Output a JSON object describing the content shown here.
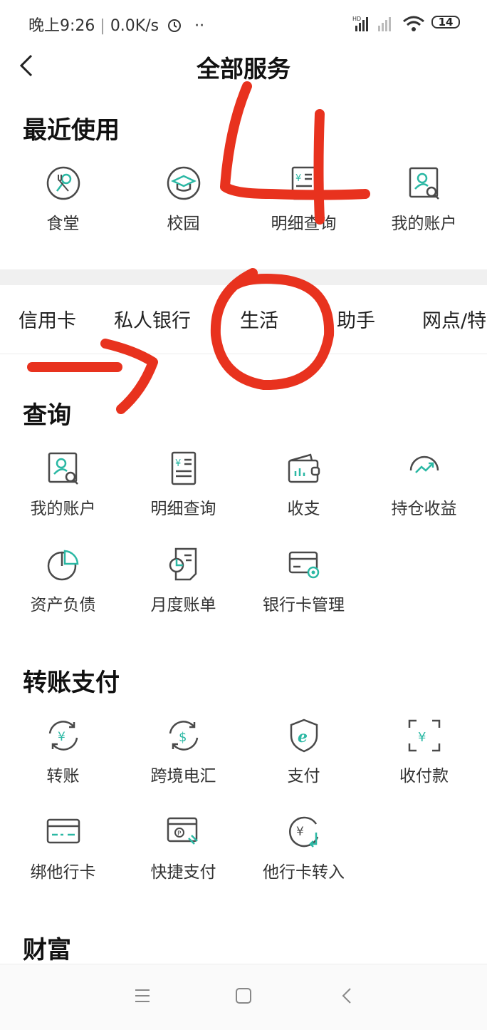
{
  "status_bar": {
    "time": "晚上9:26",
    "speed": "0.0K/s",
    "battery": "14"
  },
  "header": {
    "title": "全部服务"
  },
  "recent": {
    "title": "最近使用",
    "items": [
      {
        "label": "食堂",
        "icon": "canteen-icon"
      },
      {
        "label": "校园",
        "icon": "campus-icon"
      },
      {
        "label": "明细查询",
        "icon": "detail-query-icon"
      },
      {
        "label": "我的账户",
        "icon": "my-account-icon"
      }
    ]
  },
  "tabs": [
    "信用卡",
    "私人银行",
    "生活",
    "助手",
    "网点/特"
  ],
  "query": {
    "title": "查询",
    "items": [
      {
        "label": "我的账户",
        "icon": "my-account-icon"
      },
      {
        "label": "明细查询",
        "icon": "detail-query-icon"
      },
      {
        "label": "收支",
        "icon": "wallet-icon"
      },
      {
        "label": "持仓收益",
        "icon": "holding-profit-icon"
      },
      {
        "label": "资产负债",
        "icon": "pie-chart-icon"
      },
      {
        "label": "月度账单",
        "icon": "monthly-bill-icon"
      },
      {
        "label": "银行卡管理",
        "icon": "card-manage-icon"
      }
    ]
  },
  "transfer": {
    "title": "转账支付",
    "items": [
      {
        "label": "转账",
        "icon": "transfer-icon"
      },
      {
        "label": "跨境电汇",
        "icon": "cross-border-icon"
      },
      {
        "label": "支付",
        "icon": "pay-icon"
      },
      {
        "label": "收付款",
        "icon": "scan-receive-icon"
      },
      {
        "label": "绑他行卡",
        "icon": "bind-card-icon"
      },
      {
        "label": "快捷支付",
        "icon": "quick-pay-icon"
      },
      {
        "label": "他行卡转入",
        "icon": "card-transfer-in-icon"
      }
    ]
  },
  "wealth": {
    "title": "财富"
  },
  "annotations": {
    "number": "4",
    "color": "#e8321e"
  },
  "colors": {
    "accent": "#2bb8a4",
    "icon_stroke": "#4a4a4a"
  }
}
